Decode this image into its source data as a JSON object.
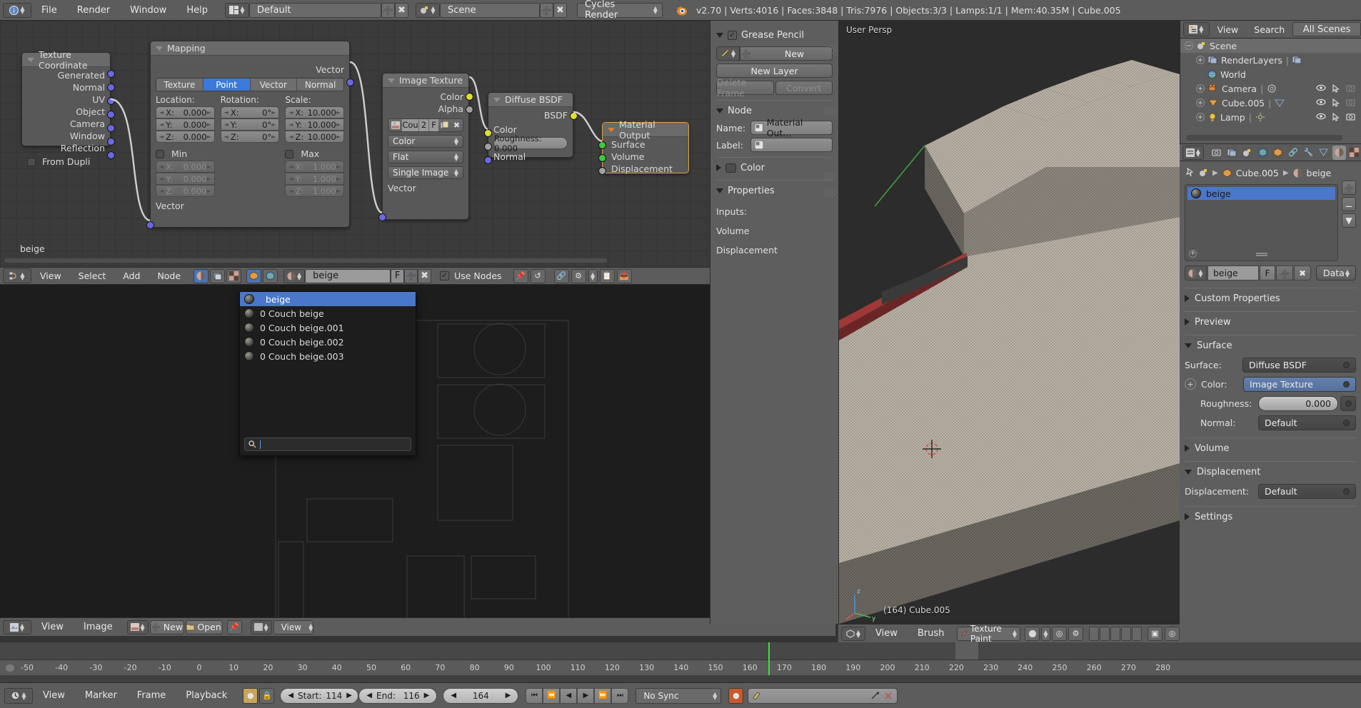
{
  "topbar": {
    "menus": [
      "File",
      "Render",
      "Window",
      "Help"
    ],
    "screen_layout": "Default",
    "scene": "Scene",
    "engine": "Cycles Render",
    "stats": "v2.70 | Verts:4016 | Faces:3848 | Tris:7976 | Objects:3/3 | Lamps:1/1 | Mem:40.35M | Cube.005"
  },
  "node_editor": {
    "menus": [
      "View",
      "Select",
      "Add",
      "Node"
    ],
    "material_name": "beige",
    "f_label": "F",
    "use_nodes_label": "Use Nodes",
    "floating_label": "beige",
    "nodes": {
      "texture_coordinate": {
        "title": "Texture Coordinate",
        "outputs": [
          "Generated",
          "Normal",
          "UV",
          "Object",
          "Camera",
          "Window",
          "Reflection"
        ],
        "option": "From Dupli"
      },
      "mapping": {
        "title": "Mapping",
        "output": "Vector",
        "input": "Vector",
        "tabs": [
          "Texture",
          "Point",
          "Vector",
          "Normal"
        ],
        "active_tab": "Point",
        "location_label": "Location:",
        "rotation_label": "Rotation:",
        "scale_label": "Scale:",
        "location": {
          "x": "0.000",
          "y": "0.000",
          "z": "0.000"
        },
        "rotation": {
          "x": "0°",
          "y": "0°",
          "z": "0°"
        },
        "scale": {
          "x": "10.000",
          "y": "10.000",
          "z": "10.000"
        },
        "min_label": "Min",
        "max_label": "Max",
        "min": {
          "x": "0.000",
          "y": "0.000",
          "z": "0.000"
        },
        "max": {
          "x": "1.000",
          "y": "1.000",
          "z": "1.000"
        },
        "axis": {
          "x": "X:",
          "y": "Y:",
          "z": "Z:"
        }
      },
      "image_texture": {
        "title": "Image Texture",
        "outputs": [
          "Color",
          "Alpha"
        ],
        "image_name": "Cou",
        "users": "2",
        "fake_user": "F",
        "color_space": "Color",
        "projection": "Flat",
        "source": "Single Image",
        "input": "Vector"
      },
      "diffuse_bsdf": {
        "title": "Diffuse BSDF",
        "output": "BSDF",
        "color_input": "Color",
        "roughness": "Roughness:  0.000",
        "normal_input": "Normal"
      },
      "material_output": {
        "title": "Material Output",
        "inputs": [
          "Surface",
          "Volume",
          "Displacement"
        ]
      }
    },
    "dropdown": {
      "items": [
        {
          "label": "beige",
          "selected": true
        },
        {
          "label": "0 Couch beige",
          "selected": false
        },
        {
          "label": "0 Couch beige.001",
          "selected": false
        },
        {
          "label": "0 Couch beige.002",
          "selected": false
        },
        {
          "label": "0 Couch beige.003",
          "selected": false
        }
      ],
      "search_value": ""
    }
  },
  "image_editor_footer": {
    "menus": [
      "View",
      "Image"
    ],
    "new_label": "New",
    "open_label": "Open",
    "view_label": "View"
  },
  "node_properties": {
    "grease_pencil": {
      "title": "Grease Pencil",
      "new_label": "New",
      "new_layer_label": "New Layer",
      "delete_frame_label": "Delete Frame",
      "convert_label": "Convert"
    },
    "node": {
      "title": "Node",
      "name_label": "Name:",
      "name_value": "Material Out...",
      "label_label": "Label:",
      "label_value": ""
    },
    "color": {
      "title": "Color"
    },
    "properties": {
      "title": "Properties",
      "rows": [
        "Inputs:",
        "Volume",
        "Displacement"
      ]
    }
  },
  "viewport": {
    "persp_label": "User Persp",
    "object_label": "(164) Cube.005",
    "footer": {
      "menus": [
        "View",
        "Brush"
      ],
      "mode": "Texture Paint"
    }
  },
  "outliner": {
    "menus": [
      "View",
      "Search"
    ],
    "display_mode": "All Scenes",
    "rows": [
      {
        "label": "Scene",
        "indent": 0,
        "icon": "scene-icon"
      },
      {
        "label": "RenderLayers",
        "indent": 1,
        "icon": "renderlayers-icon"
      },
      {
        "label": "World",
        "indent": 1,
        "icon": "world-icon"
      },
      {
        "label": "Camera",
        "indent": 1,
        "icon": "camera-icon"
      },
      {
        "label": "Cube.005",
        "indent": 1,
        "icon": "mesh-icon"
      },
      {
        "label": "Lamp",
        "indent": 1,
        "icon": "lamp-icon"
      }
    ]
  },
  "material_properties": {
    "breadcrumb": [
      "Cube.005",
      "beige"
    ],
    "slots": [
      {
        "label": "beige",
        "selected": true
      }
    ],
    "material_name": "beige",
    "fake_user": "F",
    "data_label": "Data",
    "panels": [
      {
        "title": "Custom Properties",
        "open": false
      },
      {
        "title": "Preview",
        "open": false
      },
      {
        "title": "Surface",
        "open": true
      },
      {
        "title": "Volume",
        "open": false
      },
      {
        "title": "Displacement",
        "open": true
      },
      {
        "title": "Settings",
        "open": false
      }
    ],
    "surface": {
      "surface_label": "Surface:",
      "surface_value": "Diffuse BSDF",
      "color_label": "Color:",
      "color_value": "Image Texture",
      "roughness_label": "Roughness:",
      "roughness_value": "0.000",
      "normal_label": "Normal:",
      "normal_value": "Default"
    },
    "displacement": {
      "label": "Displacement:",
      "value": "Default"
    }
  },
  "timeline": {
    "menus": [
      "View",
      "Marker",
      "Frame",
      "Playback"
    ],
    "start_label": "Start:",
    "start_value": "114",
    "end_label": "End:",
    "end_value": "116",
    "current_frame": "164",
    "sync_mode": "No Sync",
    "ticks": [
      "-50",
      "-40",
      "-30",
      "-20",
      "-10",
      "0",
      "10",
      "20",
      "30",
      "40",
      "50",
      "60",
      "70",
      "80",
      "90",
      "100",
      "110",
      "120",
      "130",
      "140",
      "150",
      "160",
      "170",
      "180",
      "190",
      "200",
      "210",
      "220",
      "230",
      "240",
      "250",
      "260",
      "270",
      "280"
    ],
    "playhead_frame": "164"
  },
  "colors": {
    "accent_blue": "#4a77c9",
    "tab_active": "#3b7ad9",
    "header_grey": "#5c5c5c",
    "panel_grey": "#5e5e5e",
    "node_body": "#585858",
    "playhead_green": "#3ce03c",
    "socket_yellow": "#dede2a",
    "socket_violet": "#6a6ae0",
    "socket_green": "#3ec93e"
  }
}
